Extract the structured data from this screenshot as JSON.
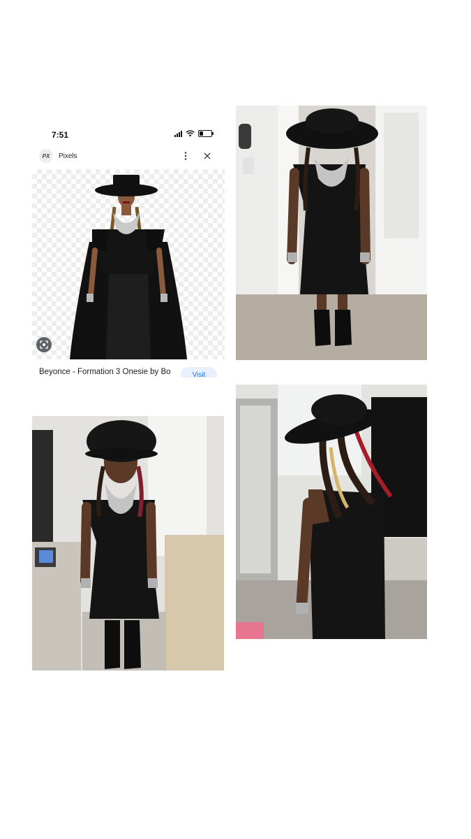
{
  "phone_screenshot": {
    "status_time": "7:51",
    "source_badge": "PX",
    "source_name": "Pixels",
    "result_title": "Beyonce - Formation 3 Onesie by Bo",
    "visit_label": "Visit"
  },
  "icons": {
    "more": "more-vert-icon",
    "close": "close-icon",
    "lens": "lens-icon"
  }
}
